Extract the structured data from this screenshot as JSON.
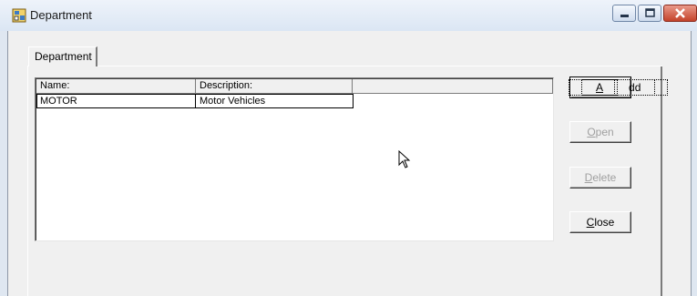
{
  "window": {
    "title": "Department"
  },
  "tab": {
    "label": "Department"
  },
  "list": {
    "columns": [
      "Name:",
      "Description:",
      ""
    ],
    "rows": [
      {
        "name": "MOTOR",
        "description": "Motor Vehicles"
      }
    ]
  },
  "buttons": {
    "add": {
      "mnemonic": "A",
      "rest": "dd"
    },
    "open": {
      "mnemonic": "O",
      "rest": "pen"
    },
    "delete": {
      "mnemonic": "D",
      "rest": "elete"
    },
    "close": {
      "mnemonic": "C",
      "rest": "lose"
    }
  },
  "colors": {
    "close_button": "#c4432b",
    "titlebar": "#dbe6f4",
    "dialog": "#f0f0f0"
  },
  "icons": [
    "department-app-icon",
    "minimize-icon",
    "maximize-icon",
    "close-icon",
    "mouse-cursor-icon"
  ]
}
